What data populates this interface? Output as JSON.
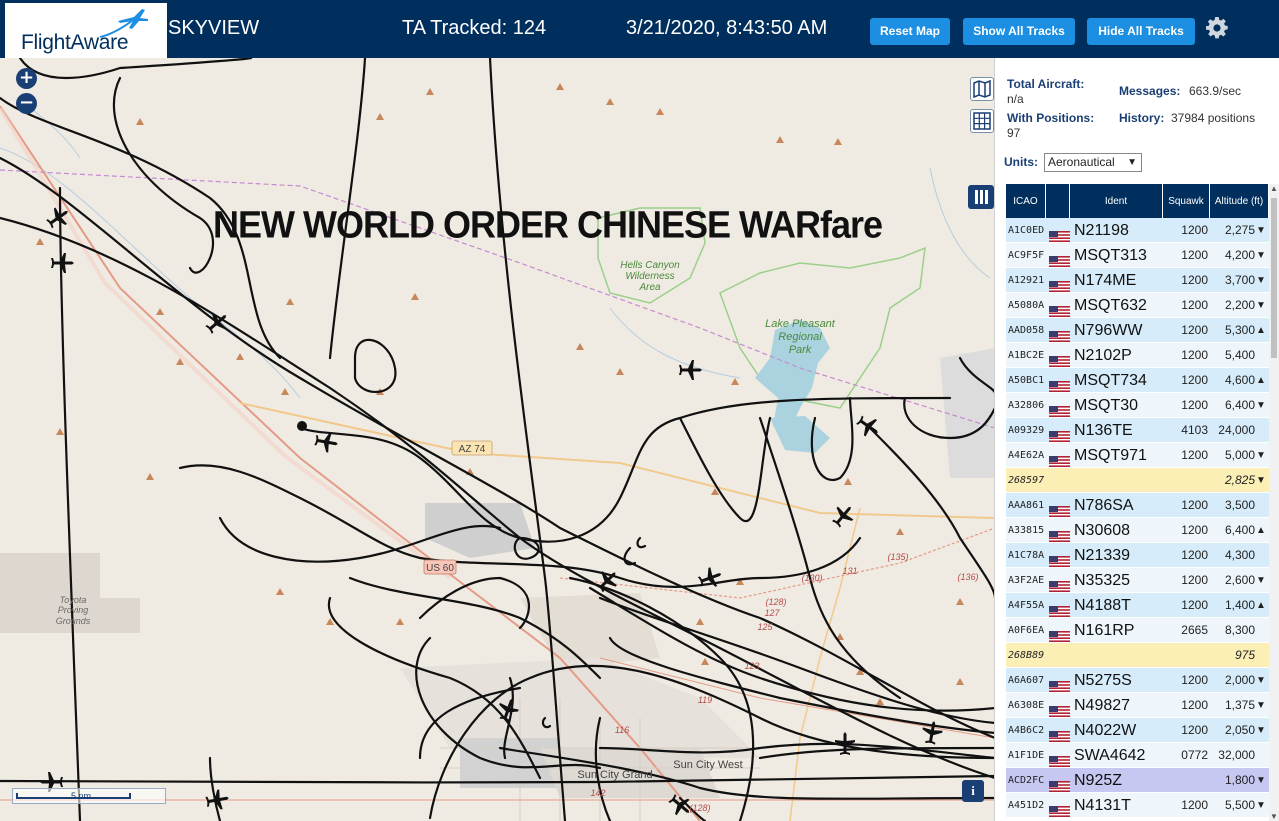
{
  "header": {
    "logo_text": "FlightAware",
    "app_title": "SKYVIEW",
    "tracked": "TA Tracked: 124",
    "datetime": "3/21/2020, 8:43:50 AM",
    "buttons": {
      "reset": "Reset Map",
      "show_all": "Show All Tracks",
      "hide_all": "Hide All Tracks"
    },
    "settings_icon": "gear-icon"
  },
  "map": {
    "overlay_headline": "NEW WORLD ORDER CHINESE WARfare",
    "zoom_in": "+",
    "zoom_out": "−",
    "scale_label": "5 nm",
    "info_label": "i",
    "labels": {
      "wilderness": [
        "Hells Canyon",
        "Wilderness",
        "Area"
      ],
      "lake": [
        "Lake Pleasant",
        "Regional",
        "Park"
      ],
      "proving": [
        "Toyota",
        "Proving",
        "Grounds"
      ],
      "az74": "AZ 74",
      "us60": "US 60",
      "sun_city_grand": "Sun City Grand",
      "sun_city_west": "Sun City West",
      "route_nums": [
        "(135)",
        "(130)",
        "131",
        "(136)",
        "(128)",
        "127",
        "125",
        "123",
        "119",
        "116",
        "142",
        "(128)"
      ]
    }
  },
  "stats": {
    "total_label": "Total Aircraft:",
    "total_value": "n/a",
    "positions_label": "With Positions:",
    "positions_value": "97",
    "messages_label": "Messages:",
    "messages_value": "663.9/sec",
    "history_label": "History:",
    "history_value": "37984 positions",
    "units_label": "Units:",
    "units_value": "Aeronautical"
  },
  "table": {
    "headers": {
      "icao": "ICAO",
      "ident": "Ident",
      "squawk": "Squawk",
      "altitude": "Altitude (ft)"
    },
    "rows": [
      {
        "icao": "A1C0ED",
        "ident": "N21198",
        "squawk": "1200",
        "alt": "2,275",
        "trend": "▼",
        "flag": true,
        "kind": "odd"
      },
      {
        "icao": "AC9F5F",
        "ident": "MSQT313",
        "squawk": "1200",
        "alt": "4,200",
        "trend": "▼",
        "flag": true,
        "kind": "even"
      },
      {
        "icao": "A12921",
        "ident": "N174ME",
        "squawk": "1200",
        "alt": "3,700",
        "trend": "▼",
        "flag": true,
        "kind": "odd"
      },
      {
        "icao": "A5080A",
        "ident": "MSQT632",
        "squawk": "1200",
        "alt": "2,200",
        "trend": "▼",
        "flag": true,
        "kind": "even"
      },
      {
        "icao": "AAD058",
        "ident": "N796WW",
        "squawk": "1200",
        "alt": "5,300",
        "trend": "▲",
        "flag": true,
        "kind": "odd"
      },
      {
        "icao": "A1BC2E",
        "ident": "N2102P",
        "squawk": "1200",
        "alt": "5,400",
        "trend": "",
        "flag": true,
        "kind": "even"
      },
      {
        "icao": "A50BC1",
        "ident": "MSQT734",
        "squawk": "1200",
        "alt": "4,600",
        "trend": "▲",
        "flag": true,
        "kind": "odd"
      },
      {
        "icao": "A32806",
        "ident": "MSQT30",
        "squawk": "1200",
        "alt": "6,400",
        "trend": "▼",
        "flag": true,
        "kind": "even"
      },
      {
        "icao": "A09329",
        "ident": "N136TE",
        "squawk": "4103",
        "alt": "24,000",
        "trend": "",
        "flag": true,
        "kind": "odd"
      },
      {
        "icao": "A4E62A",
        "ident": "MSQT971",
        "squawk": "1200",
        "alt": "5,000",
        "trend": "▼",
        "flag": true,
        "kind": "even"
      },
      {
        "icao": "268597",
        "ident": "",
        "squawk": "",
        "alt": "2,825",
        "trend": "▼",
        "flag": false,
        "kind": "noident"
      },
      {
        "icao": "AAA861",
        "ident": "N786SA",
        "squawk": "1200",
        "alt": "3,500",
        "trend": "",
        "flag": true,
        "kind": "odd"
      },
      {
        "icao": "A33815",
        "ident": "N30608",
        "squawk": "1200",
        "alt": "6,400",
        "trend": "▲",
        "flag": true,
        "kind": "even"
      },
      {
        "icao": "A1C78A",
        "ident": "N21339",
        "squawk": "1200",
        "alt": "4,300",
        "trend": "",
        "flag": true,
        "kind": "odd"
      },
      {
        "icao": "A3F2AE",
        "ident": "N35325",
        "squawk": "1200",
        "alt": "2,600",
        "trend": "▼",
        "flag": true,
        "kind": "even"
      },
      {
        "icao": "A4F55A",
        "ident": "N4188T",
        "squawk": "1200",
        "alt": "1,400",
        "trend": "▲",
        "flag": true,
        "kind": "odd"
      },
      {
        "icao": "A0F6EA",
        "ident": "N161RP",
        "squawk": "2665",
        "alt": "8,300",
        "trend": "",
        "flag": true,
        "kind": "even"
      },
      {
        "icao": "268B89",
        "ident": "",
        "squawk": "",
        "alt": "975",
        "trend": "",
        "flag": false,
        "kind": "noident"
      },
      {
        "icao": "A6A607",
        "ident": "N5275S",
        "squawk": "1200",
        "alt": "2,000",
        "trend": "▼",
        "flag": true,
        "kind": "odd"
      },
      {
        "icao": "A6308E",
        "ident": "N49827",
        "squawk": "1200",
        "alt": "1,375",
        "trend": "▼",
        "flag": true,
        "kind": "even"
      },
      {
        "icao": "A4B6C2",
        "ident": "N4022W",
        "squawk": "1200",
        "alt": "2,050",
        "trend": "▼",
        "flag": true,
        "kind": "odd"
      },
      {
        "icao": "A1F1DE",
        "ident": "SWA4642",
        "squawk": "0772",
        "alt": "32,000",
        "trend": "",
        "flag": true,
        "kind": "even"
      },
      {
        "icao": "ACD2FC",
        "ident": "N925Z",
        "squawk": "",
        "alt": "1,800",
        "trend": "▼",
        "flag": true,
        "kind": "selected"
      },
      {
        "icao": "A451D2",
        "ident": "N4131T",
        "squawk": "1200",
        "alt": "5,500",
        "trend": "▼",
        "flag": true,
        "kind": "even"
      }
    ]
  },
  "colors": {
    "header_bg": "#002f5d",
    "button_blue": "#1c8fe3",
    "map_bg": "#efebe3",
    "track_line": "#111111",
    "row_odd": "#d7ecfa",
    "row_even": "#eef6fc",
    "row_noident": "#fbefb6",
    "row_selected": "#c6c8f1"
  }
}
